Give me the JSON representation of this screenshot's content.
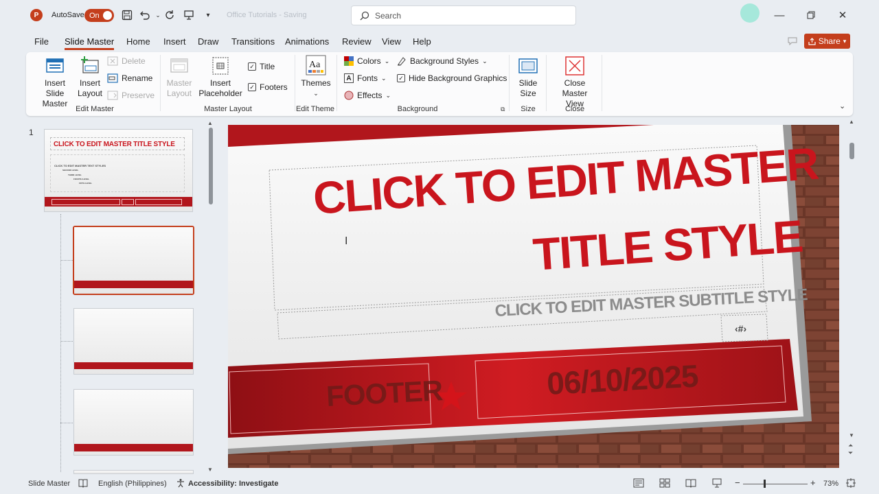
{
  "app": {
    "logo_letter": "P",
    "autosave_label": "AutoSave",
    "autosave_state": "On",
    "doc_title": "Office Tutorials - Saving",
    "search_placeholder": "Search",
    "share_label": "Share"
  },
  "menu_tabs": [
    "File",
    "Slide Master",
    "Home",
    "Insert",
    "Draw",
    "Transitions",
    "Animations",
    "Review",
    "View",
    "Help"
  ],
  "ribbon": {
    "insert_slide_master": "Insert Slide Master",
    "insert_layout": "Insert Layout",
    "delete": "Delete",
    "rename": "Rename",
    "preserve": "Preserve",
    "master_layout": "Master Layout",
    "insert_placeholder": "Insert Placeholder",
    "title_chk": "Title",
    "footers_chk": "Footers",
    "themes": "Themes",
    "colors": "Colors",
    "fonts": "Fonts",
    "effects": "Effects",
    "background_styles": "Background Styles",
    "hide_bg_graphics": "Hide Background Graphics",
    "slide_size": "Slide Size",
    "close_master_view": "Close Master View",
    "groups": {
      "edit_master": "Edit Master",
      "master_layout": "Master Layout",
      "edit_theme": "Edit Theme",
      "background": "Background",
      "size": "Size",
      "close": "Close"
    }
  },
  "thumbnails": {
    "slide_number": "1",
    "master_title": "CLICK TO EDIT MASTER TITLE STYLE",
    "master_text": "CLICK TO EDIT MASTER TEXT STYLES",
    "levels": [
      "SECOND LEVEL",
      "THIRD LEVEL",
      "FOURTH LEVEL",
      "FIFTH LEVEL"
    ]
  },
  "slide": {
    "title_line1": "CLICK TO EDIT MASTER",
    "title_line2": "TITLE STYLE",
    "subtitle": "CLICK TO EDIT MASTER SUBTITLE STYLE",
    "slide_number": "‹#›",
    "footer": "FOOTER",
    "date": "06/10/2025"
  },
  "status": {
    "mode": "Slide Master",
    "language": "English (Philippines)",
    "accessibility": "Accessibility: Investigate",
    "zoom": "73%"
  },
  "colors": {
    "accent": "#c43e1c",
    "slide_red": "#b1161c",
    "title_red": "#c9151d",
    "brick": "#6b3a2d"
  }
}
